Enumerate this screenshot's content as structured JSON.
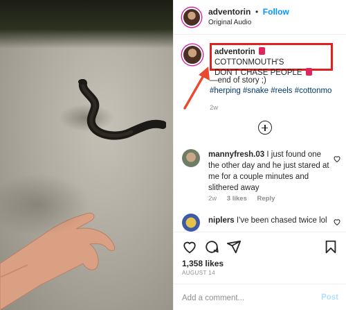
{
  "post": {
    "username": "adventorin",
    "separator": "•",
    "follow_label": "Follow",
    "audio": "Original Audio"
  },
  "caption": {
    "username": "adventorin",
    "text_line1": "COTTONMOUTH'S",
    "text_line2": "DON'T CHASE PEOPLE",
    "body": "—end of story ;)",
    "hashtags": "#herping #snake #reels #cottonmo",
    "time": "2w"
  },
  "comments": [
    {
      "username": "mannyfresh.03",
      "text": "I just found one the other day and he just stared at me for a couple minutes and slithered away",
      "time": "2w",
      "likes": "3 likes",
      "reply": "Reply"
    },
    {
      "username": "niplers",
      "text": "I've been chased twice lol"
    }
  ],
  "footer": {
    "likes": "1,358 likes",
    "date": "AUGUST 14",
    "comment_placeholder": "Add a comment...",
    "post_label": "Post"
  },
  "colors": {
    "accent": "#0095f6",
    "highlight_box": "#e02020",
    "arrow": "#e84a2e"
  }
}
